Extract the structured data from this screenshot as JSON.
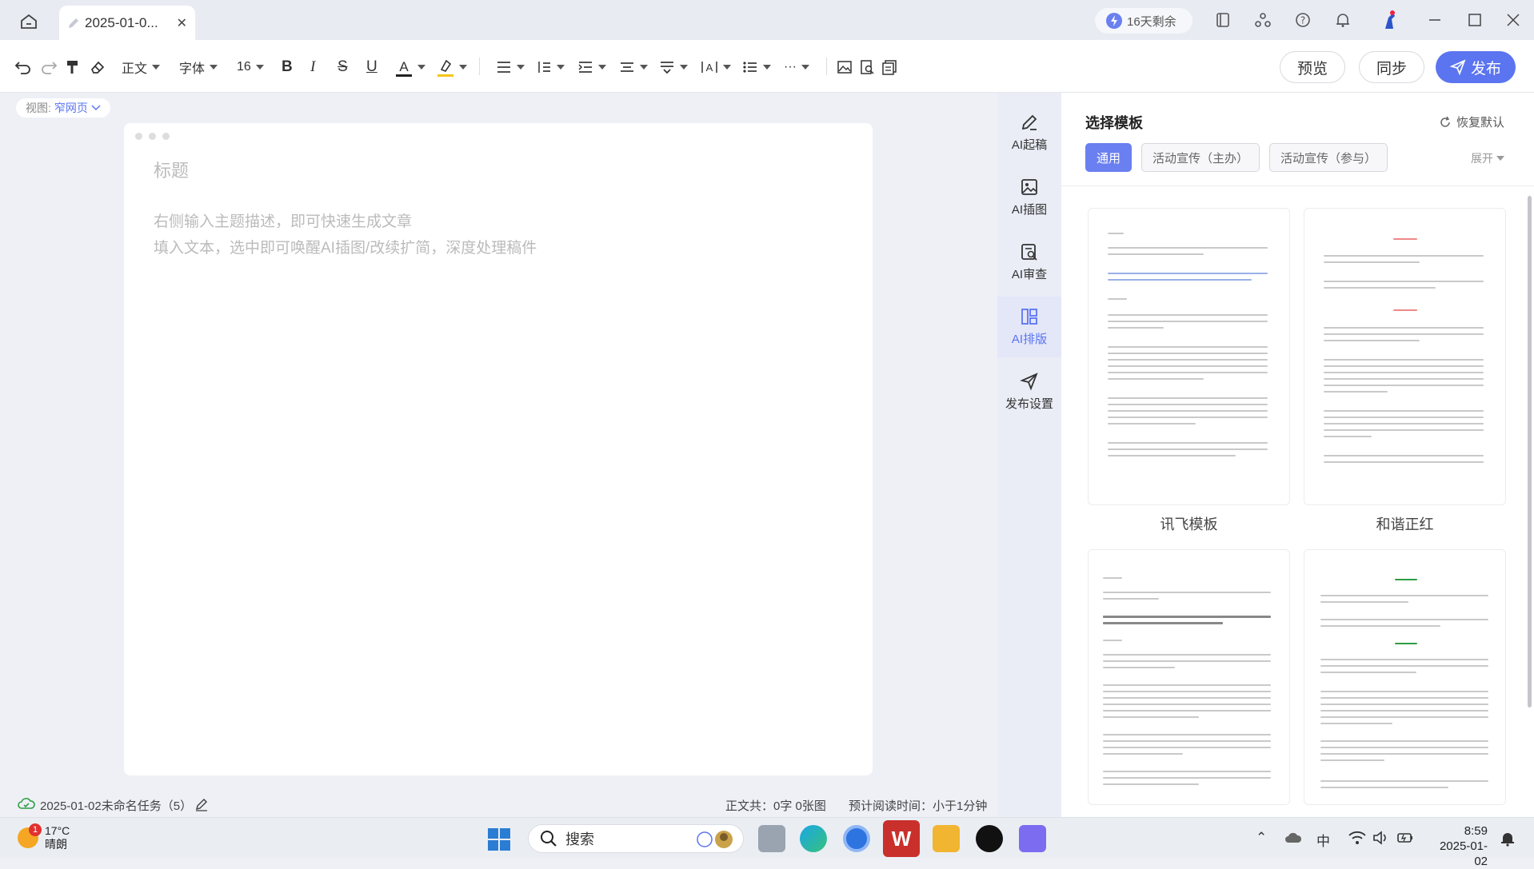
{
  "titlebar": {
    "tab_title": "2025-01-0...",
    "trial_label": "16天剩余"
  },
  "toolbar": {
    "paragraph_style": "正文",
    "font_family": "字体",
    "font_size": "16",
    "preview_label": "预览",
    "sync_label": "同步",
    "publish_label": "发布",
    "more_label": "···"
  },
  "editor": {
    "view_prefix": "视图:",
    "view_value": "窄网页",
    "title_placeholder": "标题",
    "body_placeholder_1": "右侧输入主题描述，即可快速生成文章",
    "body_placeholder_2": "填入文本，选中即可唤醒AI插图/改续扩简，深度处理稿件"
  },
  "statusbar": {
    "task_name": "2025-01-02未命名任务（5）",
    "word_count": "正文共：0字 0张图",
    "reading_time": "预计阅读时间：小于1分钟"
  },
  "ai_strip": {
    "items": [
      {
        "label": "AI起稿",
        "icon": "pen-icon"
      },
      {
        "label": "AI插图",
        "icon": "image-icon"
      },
      {
        "label": "AI审查",
        "icon": "review-icon"
      },
      {
        "label": "AI排版",
        "icon": "layout-icon"
      },
      {
        "label": "发布设置",
        "icon": "send-icon"
      }
    ],
    "active_index": 3
  },
  "panel": {
    "title": "选择模板",
    "restore_label": "恢复默认",
    "tabs": [
      "通用",
      "活动宣传（主办）",
      "活动宣传（参与）"
    ],
    "selected_tab": 0,
    "expand_label": "展开",
    "templates": [
      {
        "name": "讯飞模板",
        "accent": "#4a7bd8"
      },
      {
        "name": "和谐正红",
        "accent": "#e03131"
      },
      {
        "name": "",
        "accent": "#333333"
      },
      {
        "name": "",
        "accent": "#2f9e44"
      }
    ]
  },
  "taskbar": {
    "temperature": "17°C",
    "weather": "晴朗",
    "notification_count": "1",
    "search_label": "搜索",
    "ime_label": "中",
    "time": "8:59",
    "date": "2025-01-02"
  },
  "colors": {
    "accent": "#5b74f0",
    "panel_tab_selected": "#6a7ff0"
  }
}
